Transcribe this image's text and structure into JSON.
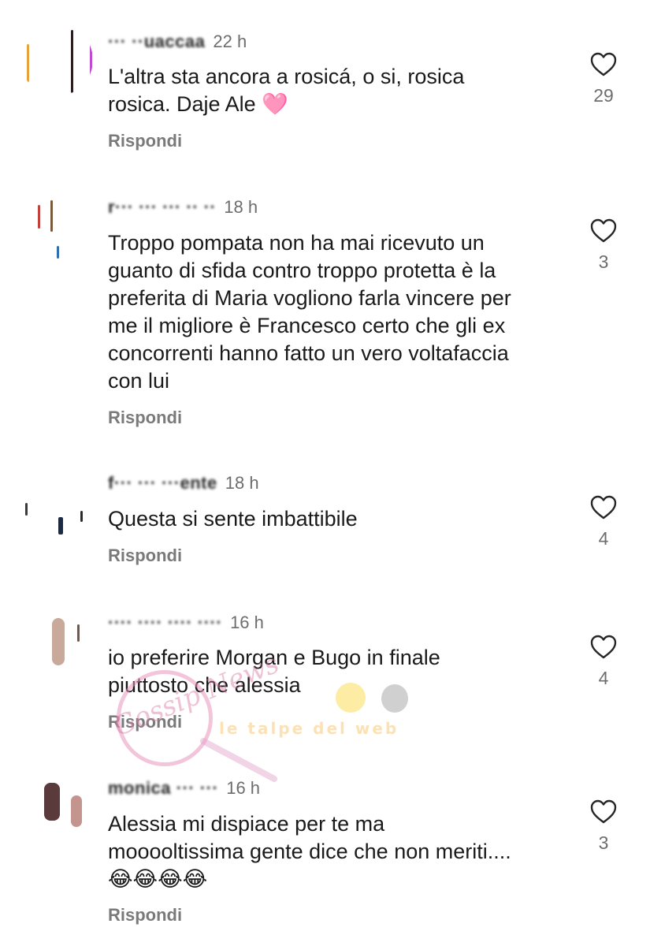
{
  "comments": [
    {
      "username": "··· ··uaccaa",
      "time": "22 h",
      "text_lines": [
        "L'altra sta ancora a rosicá, o si, rosica",
        "rosica. Daje Ale 🩷"
      ],
      "reply_label": "Rispondi",
      "likes": "29"
    },
    {
      "username": "r··· ··· ··· ·· ··",
      "time": "18 h",
      "text_lines": [
        "Troppo pompata non ha mai ricevuto un",
        "guanto di sfida contro troppo protetta è la",
        "preferita di Maria vogliono farla vincere per",
        "me il migliore è Francesco certo che gli ex",
        "concorrenti hanno fatto un vero voltafaccia",
        "con lui"
      ],
      "reply_label": "Rispondi",
      "likes": "3"
    },
    {
      "username": "f··· ··· ···ente",
      "time": "18 h",
      "text_lines": [
        "Questa si sente imbattibile"
      ],
      "reply_label": "Rispondi",
      "likes": "4"
    },
    {
      "username": "···· ···· ···· ····",
      "time": "16 h",
      "text_lines": [
        "io preferire Morgan e Bugo in finale",
        "piuttosto che alessia"
      ],
      "reply_label": "Rispondi",
      "likes": "4"
    },
    {
      "username": "monica ··· ···",
      "time": "16 h",
      "text_lines": [
        "Alessia mi dispiace per te ma",
        "mooooltissima gente dice che non meriti....",
        "😂😂😂😂"
      ],
      "reply_label": "Rispondi",
      "likes": "3"
    }
  ],
  "watermark": {
    "script_text": "Gossip News",
    "band_text": "le talpe del web"
  },
  "colors": {
    "text": "#1a1a1a",
    "meta": "#6d6d6d",
    "reply": "#7a7a7a",
    "heart_stroke": "#262626"
  },
  "icons": {
    "like": "heart-outline-icon"
  }
}
